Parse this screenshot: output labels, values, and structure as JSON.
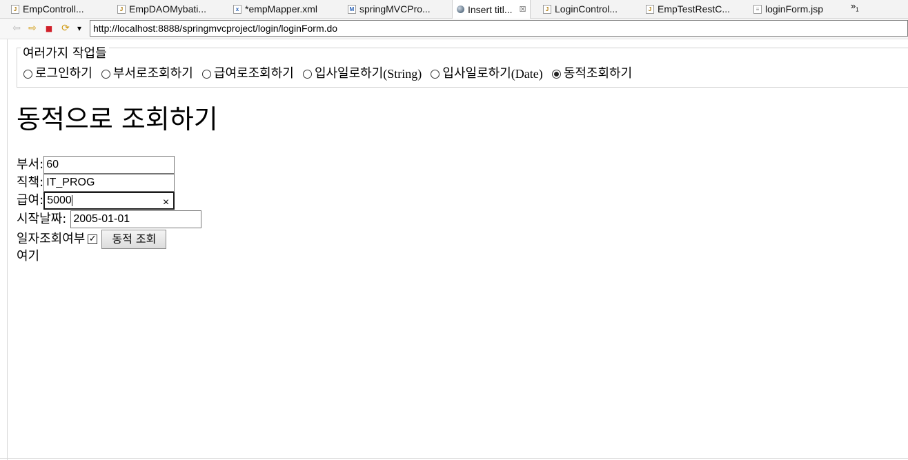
{
  "tabs": [
    {
      "label": "EmpControll...",
      "icon": "java-file-icon",
      "active": false
    },
    {
      "label": "EmpDAOMybati...",
      "icon": "java-file-icon",
      "active": false
    },
    {
      "label": "*empMapper.xml",
      "icon": "xml-file-icon",
      "active": false
    },
    {
      "label": "springMVCPro...",
      "icon": "manifest-file-icon",
      "active": false
    },
    {
      "label": "Insert titl...",
      "icon": "globe-icon",
      "active": true,
      "close": "☒"
    },
    {
      "label": "LoginControl...",
      "icon": "java-file-icon",
      "active": false
    },
    {
      "label": "EmpTestRestC...",
      "icon": "java-file-icon",
      "active": false
    },
    {
      "label": "loginForm.jsp",
      "icon": "jsp-file-icon",
      "active": false
    }
  ],
  "tab_overflow": {
    "symbol": "»",
    "count": "1"
  },
  "toolbar": {
    "back_icon": "⇦",
    "forward_icon": "⇨",
    "stop_icon": "■",
    "refresh_icon": "⟳",
    "menu_icon": "▾",
    "url": "http://localhost:8888/springmvcproject/login/loginForm.do"
  },
  "tasks": {
    "legend": "여러가지 작업들",
    "options": [
      {
        "label": "로그인하기",
        "suffix": "",
        "checked": false
      },
      {
        "label": "부서로조회하기",
        "suffix": "",
        "checked": false
      },
      {
        "label": "급여로조회하기",
        "suffix": "",
        "checked": false
      },
      {
        "label": "입사일로하기",
        "suffix": "(String)",
        "checked": false
      },
      {
        "label": "입사일로하기",
        "suffix": "(Date)",
        "checked": false
      },
      {
        "label": "동적조회하기",
        "suffix": "",
        "checked": true
      }
    ]
  },
  "page_title": "동적으로 조회하기",
  "form": {
    "dept_label": "부서:",
    "dept_value": "60",
    "job_label": "직책:",
    "job_value": "IT_PROG",
    "salary_label": "급여:",
    "salary_value": "5000",
    "salary_clear": "×",
    "start_date_label": "시작날짜:",
    "start_date_value": "2005-01-01",
    "date_check_label": "일자조회여부",
    "date_check_mark": "✓",
    "date_check_checked": true,
    "submit_label": "동적 조회"
  },
  "result_text": "여기"
}
